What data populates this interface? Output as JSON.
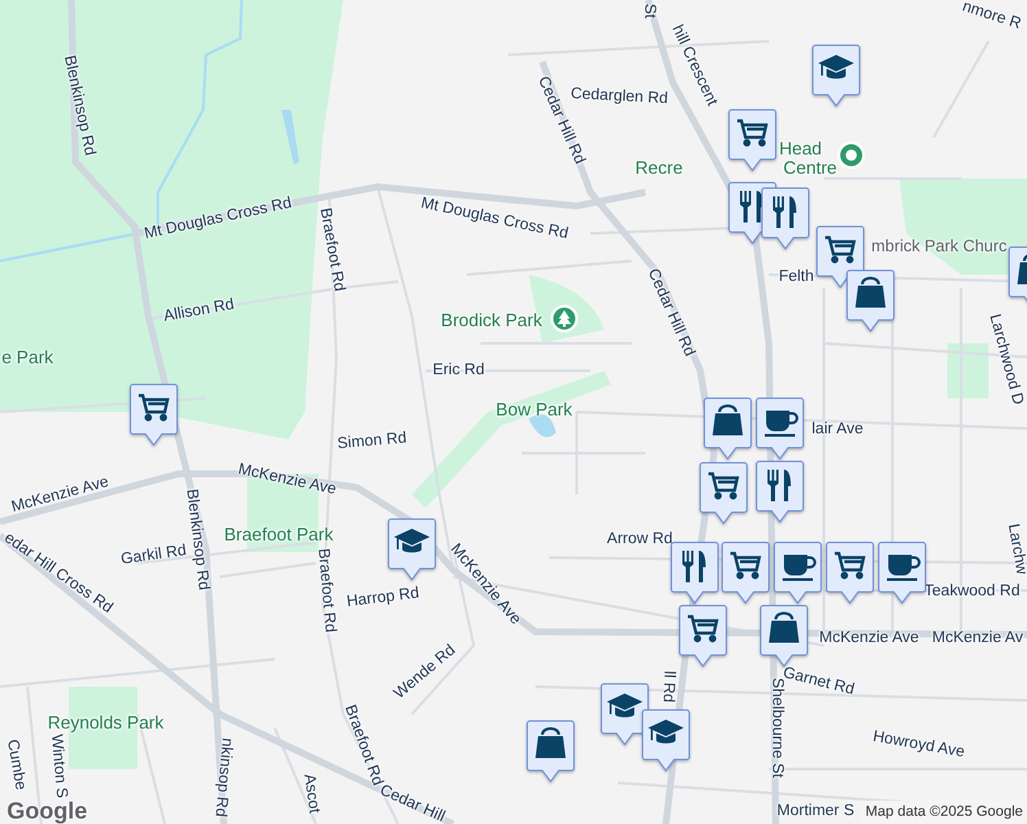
{
  "map": {
    "labels": [
      {
        "text": "St",
        "kind": "road"
      },
      {
        "text": "nmore R",
        "kind": "road"
      },
      {
        "text": "hill Crescent",
        "kind": "road"
      },
      {
        "text": "Cedarglen Rd",
        "kind": "road"
      },
      {
        "text": "Blenkinsop Rd",
        "kind": "road"
      },
      {
        "text": "Cedar Hill Rd",
        "kind": "road"
      },
      {
        "text": "Head",
        "kind": "park"
      },
      {
        "text": "Recre",
        "kind": "park"
      },
      {
        "text": "Centre",
        "kind": "park"
      },
      {
        "text": "Mt Douglas Cross Rd",
        "kind": "road"
      },
      {
        "text": "Mt Douglas Cross Rd",
        "kind": "road"
      },
      {
        "text": "mbrick Park Churc",
        "kind": "place"
      },
      {
        "text": "Braefoot Rd",
        "kind": "road"
      },
      {
        "text": "Felth",
        "kind": "road"
      },
      {
        "text": "Allison Rd",
        "kind": "road"
      },
      {
        "text": "Cedar Hill Rd",
        "kind": "road"
      },
      {
        "text": "Brodick Park",
        "kind": "park"
      },
      {
        "text": "e Park",
        "kind": "park"
      },
      {
        "text": "Larchwood D",
        "kind": "road"
      },
      {
        "text": "Eric Rd",
        "kind": "road"
      },
      {
        "text": "Bow Park",
        "kind": "park"
      },
      {
        "text": "lair Ave",
        "kind": "road"
      },
      {
        "text": "Simon Rd",
        "kind": "road"
      },
      {
        "text": "McKenzie Ave",
        "kind": "road"
      },
      {
        "text": "McKenzie Ave",
        "kind": "road"
      },
      {
        "text": "Braefoot Park",
        "kind": "park"
      },
      {
        "text": "Blenkinsop Rd",
        "kind": "road"
      },
      {
        "text": "Arrow Rd",
        "kind": "road"
      },
      {
        "text": "Larchw",
        "kind": "road"
      },
      {
        "text": "Garkil Rd",
        "kind": "road"
      },
      {
        "text": "edar Hill Cross Rd",
        "kind": "road"
      },
      {
        "text": "McKenzie Ave",
        "kind": "road"
      },
      {
        "text": "Braefoot Rd",
        "kind": "road"
      },
      {
        "text": "Teakwood Rd",
        "kind": "road"
      },
      {
        "text": "Harrop Rd",
        "kind": "road"
      },
      {
        "text": "McKenzie Ave",
        "kind": "road"
      },
      {
        "text": "McKenzie Av",
        "kind": "road"
      },
      {
        "text": "Wende Rd",
        "kind": "road"
      },
      {
        "text": "Garnet Rd",
        "kind": "road"
      },
      {
        "text": "ll Rd",
        "kind": "road"
      },
      {
        "text": "Shelbourne St",
        "kind": "road"
      },
      {
        "text": "Reynolds Park",
        "kind": "park"
      },
      {
        "text": "Braefoot Rd",
        "kind": "road"
      },
      {
        "text": "Howroyd Ave",
        "kind": "road"
      },
      {
        "text": "Winton S",
        "kind": "road"
      },
      {
        "text": "Cumbe",
        "kind": "road"
      },
      {
        "text": "nkinsop Rd",
        "kind": "road"
      },
      {
        "text": "Ascot",
        "kind": "road"
      },
      {
        "text": "Cedar Hill",
        "kind": "road"
      },
      {
        "text": "Mortimer S",
        "kind": "road"
      }
    ],
    "pois": [
      {
        "kind": "tree"
      },
      {
        "kind": "dot"
      }
    ],
    "markers": [
      {
        "kind": "cap"
      },
      {
        "kind": "cart"
      },
      {
        "kind": "fork"
      },
      {
        "kind": "fork"
      },
      {
        "kind": "cart"
      },
      {
        "kind": "bag"
      },
      {
        "kind": "bag"
      },
      {
        "kind": "cart"
      },
      {
        "kind": "bag"
      },
      {
        "kind": "cup"
      },
      {
        "kind": "fork"
      },
      {
        "kind": "cart"
      },
      {
        "kind": "cup"
      },
      {
        "kind": "cart"
      },
      {
        "kind": "cart"
      },
      {
        "kind": "cup"
      },
      {
        "kind": "fork"
      },
      {
        "kind": "cart"
      },
      {
        "kind": "bag"
      },
      {
        "kind": "cap"
      },
      {
        "kind": "cap"
      },
      {
        "kind": "cap"
      },
      {
        "kind": "bag"
      }
    ],
    "logo": "Google",
    "attribution": "Map data ©2025 Google"
  }
}
